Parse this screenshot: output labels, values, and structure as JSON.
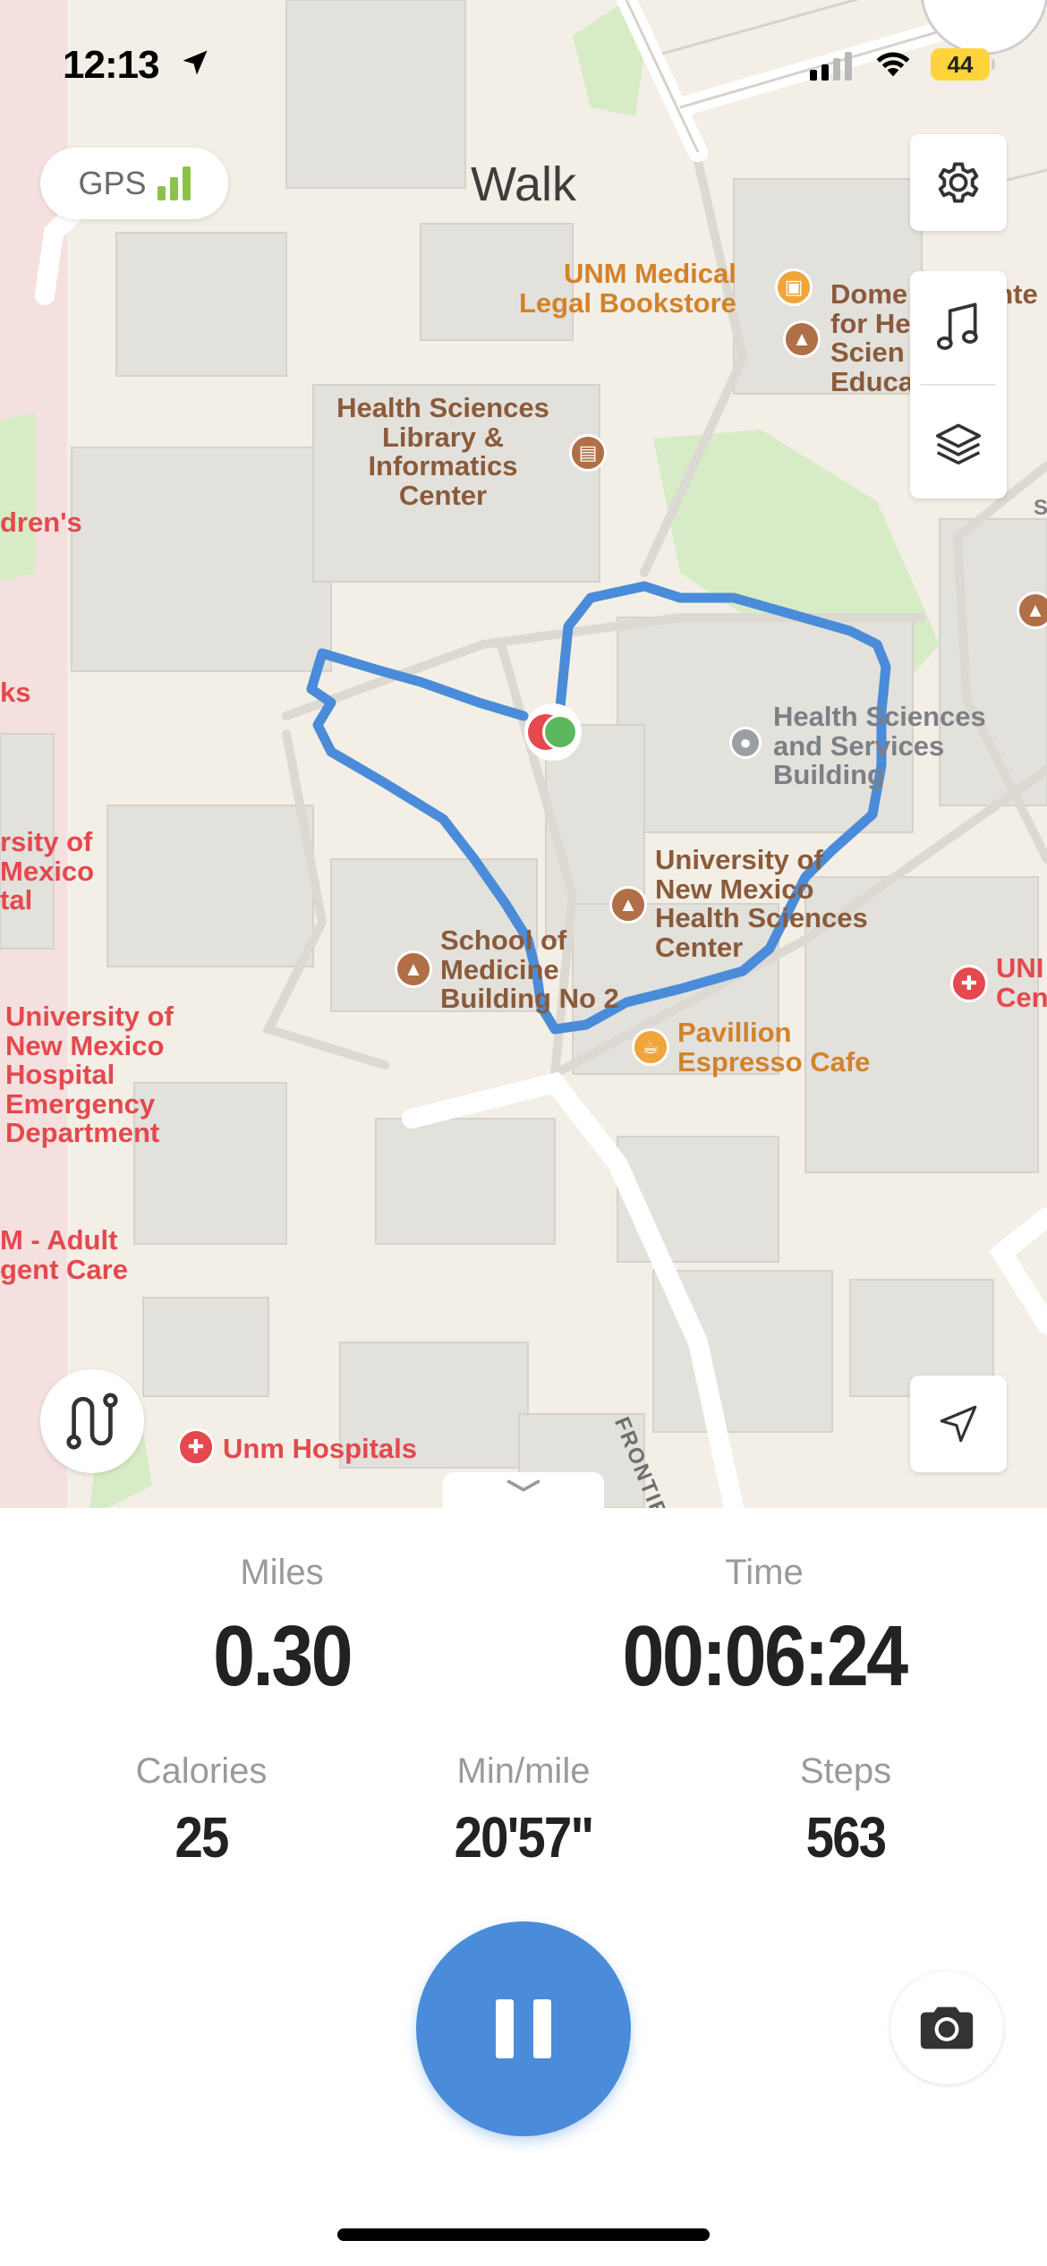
{
  "status_bar": {
    "time": "12:13",
    "battery": "44"
  },
  "gps": {
    "label": "GPS"
  },
  "activity": {
    "title": "Walk"
  },
  "map_labels": {
    "unm_bookstore": [
      "UNM Medical",
      "Legal Bookstore"
    ],
    "domenici": [
      "Dome",
      "for He",
      "Scien",
      "Educa"
    ],
    "domenici_tail": "ente",
    "hs_library": [
      "Health Sciences",
      "Library &",
      "Informatics",
      "Center"
    ],
    "childrens": "dren's",
    "ks": "ks",
    "hs_services": [
      "Health Sciences",
      "and Services",
      "Building"
    ],
    "unm_left": [
      "rsity of",
      "Mexico",
      "tal"
    ],
    "unm_hsc": [
      "University of",
      "New Mexico",
      "Health Sciences",
      "Center"
    ],
    "school_medicine": [
      "School of",
      "Medicine",
      "Building No 2"
    ],
    "unm_hospital_ed": [
      "University of",
      "New Mexico",
      "Hospital",
      "Emergency",
      "Department"
    ],
    "pavillion": [
      "Pavillion",
      "Espresso Cafe"
    ],
    "uni_right": [
      "UNI",
      "Cen"
    ],
    "urgent_care": [
      "M - Adult",
      "gent Care"
    ],
    "unm_hospitals": "Unm Hospitals",
    "street": "FRONTIER AVE",
    "s_edge": "S"
  },
  "stats": {
    "miles": {
      "label": "Miles",
      "value": "0.30"
    },
    "time": {
      "label": "Time",
      "value": "00:06:24"
    },
    "calories": {
      "label": "Calories",
      "value": "25"
    },
    "pace": {
      "label": "Min/mile",
      "value": "20'57\""
    },
    "steps": {
      "label": "Steps",
      "value": "563"
    }
  },
  "icons": [
    "location-arrow-icon",
    "signal-icon",
    "wifi-icon",
    "settings-gear-icon",
    "music-note-icon",
    "map-layers-icon",
    "route-icon",
    "navigate-arrow-icon",
    "chevron-down-icon",
    "pause-icon",
    "camera-icon"
  ],
  "colors": {
    "route": "#4a8cd9",
    "accent": "#4a8cd9",
    "gps_bars": "#8bc34a",
    "battery": "#ffd43b"
  }
}
